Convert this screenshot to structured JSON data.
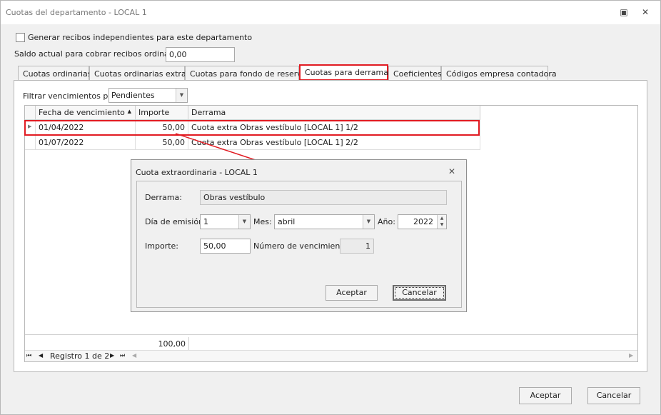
{
  "window": {
    "title": "Cuotas del departamento - LOCAL 1"
  },
  "top": {
    "checkbox_label": "Generar recibos independientes para este departamento",
    "saldo_label": "Saldo actual para cobrar recibos ordinarios:",
    "saldo_value": "0,00"
  },
  "tabs": [
    {
      "label": "Cuotas ordinarias"
    },
    {
      "label": "Cuotas ordinarias extras"
    },
    {
      "label": "Cuotas para fondo de reserva"
    },
    {
      "label": "Cuotas para derramas"
    },
    {
      "label": "Coeficientes"
    },
    {
      "label": "Códigos empresa contadora"
    }
  ],
  "filter": {
    "label": "Filtrar vencimientos por:",
    "value": "Pendientes"
  },
  "grid": {
    "columns": [
      "Fecha de vencimiento",
      "Importe",
      "Derrama"
    ],
    "rows": [
      {
        "fecha": "01/04/2022",
        "importe": "50,00",
        "derrama": "Cuota extra Obras vestíbulo [LOCAL 1] 1/2"
      },
      {
        "fecha": "01/07/2022",
        "importe": "50,00",
        "derrama": "Cuota extra Obras vestíbulo [LOCAL 1] 2/2"
      }
    ],
    "total": "100,00",
    "navigator": "Registro 1 de 2"
  },
  "dialog": {
    "title": "Cuota extraordinaria - LOCAL 1",
    "derrama_label": "Derrama:",
    "derrama_value": "Obras vestíbulo",
    "dia_label": "Día de emisión:",
    "dia_value": "1",
    "mes_label": "Mes:",
    "mes_value": "abril",
    "anio_label": "Año:",
    "anio_value": "2022",
    "importe_label": "Importe:",
    "importe_value": "50,00",
    "numero_label": "Número de vencimiento:",
    "numero_value": "1",
    "accept_label": "Aceptar",
    "cancel_label": "Cancelar"
  },
  "footer": {
    "accept_label": "Aceptar",
    "cancel_label": "Cancelar"
  },
  "colors": {
    "highlight": "#e11b22"
  }
}
